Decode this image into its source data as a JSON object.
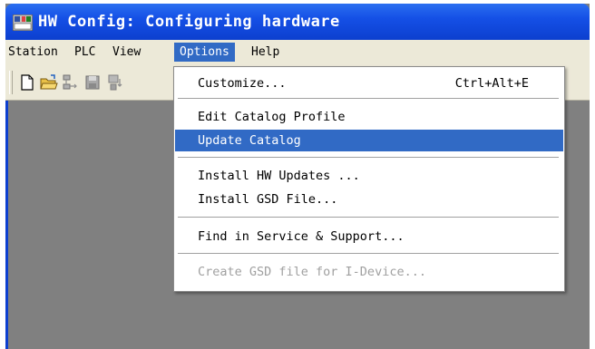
{
  "window": {
    "title": "HW Config: Configuring hardware"
  },
  "menubar": {
    "items": [
      {
        "label": "Station"
      },
      {
        "label": "PLC"
      },
      {
        "label": "View"
      },
      {
        "label": "Options"
      },
      {
        "label": "Help"
      }
    ]
  },
  "toolbar": {
    "buttons": [
      "new-document-icon",
      "open-folder-icon",
      "network-icon",
      "save-disk-icon",
      "download-icon"
    ]
  },
  "options_menu": {
    "items": [
      {
        "label": "Customize...",
        "accelerator": "Ctrl+Alt+E"
      },
      {
        "label": "Edit Catalog Profile"
      },
      {
        "label": "Update Catalog"
      },
      {
        "label": "Install HW Updates ..."
      },
      {
        "label": "Install GSD File..."
      },
      {
        "label": "Find in Service & Support..."
      },
      {
        "label": "Create GSD file for I-Device..."
      }
    ]
  },
  "colors": {
    "titlebar": "#0c3fcf",
    "highlight": "#316ac5",
    "menubar": "#ece9d8",
    "workspace": "#808080"
  }
}
